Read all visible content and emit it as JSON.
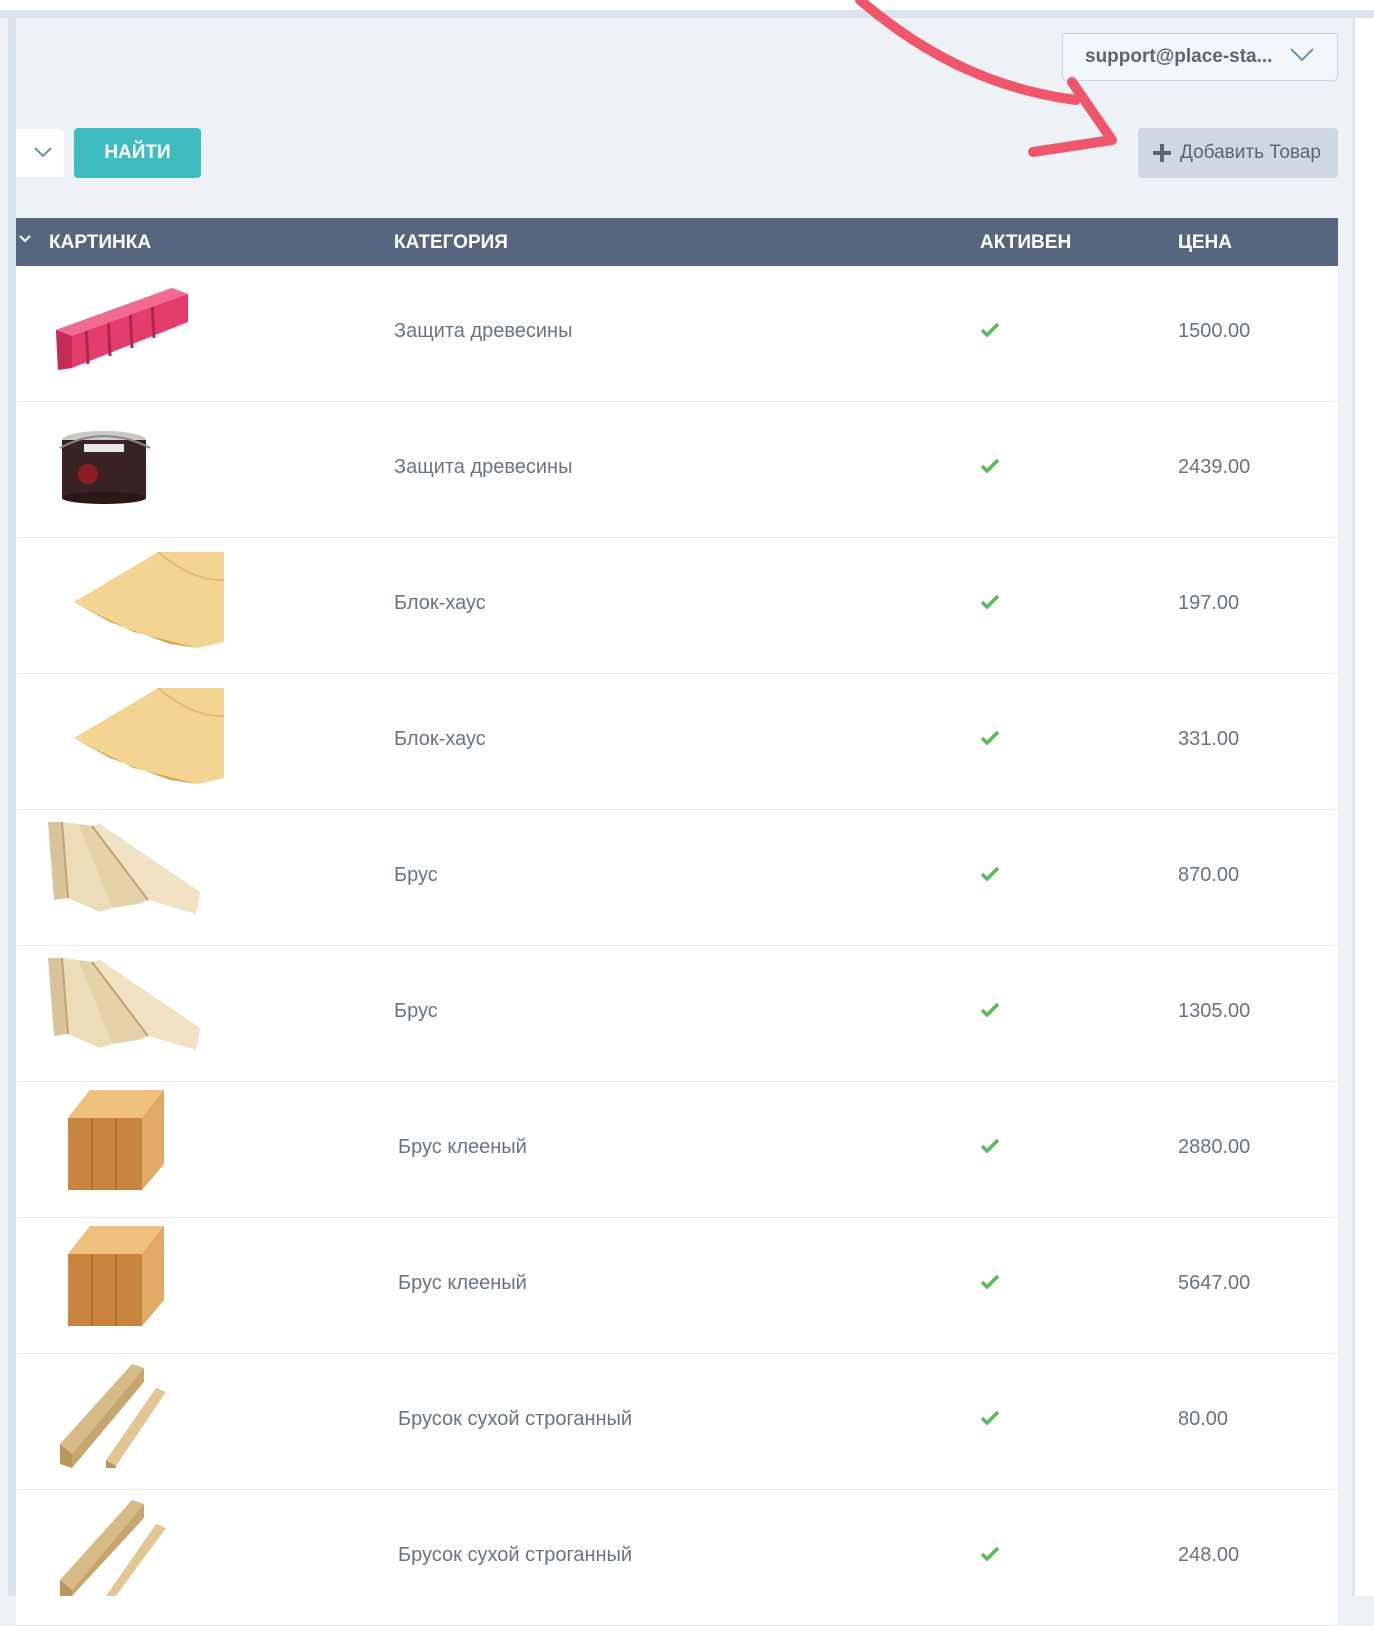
{
  "header": {
    "user_email": "support@place-sta...",
    "find_label": "НАЙТИ",
    "add_label": "Добавить Товар"
  },
  "table": {
    "columns": [
      "КАРТИНКА",
      "КАТЕГОРИЯ",
      "АКТИВЕН",
      "ЦЕНА"
    ],
    "rows": [
      {
        "image": "pink-boards-image",
        "category": "Защита древесины",
        "active": true,
        "price": "1500.00"
      },
      {
        "image": "paint-can-image",
        "category": "Защита древесины",
        "active": true,
        "price": "2439.00"
      },
      {
        "image": "block-house-image",
        "category": "Блок-хаус",
        "active": true,
        "price": "197.00"
      },
      {
        "image": "block-house-image",
        "category": "Блок-хаус",
        "active": true,
        "price": "331.00"
      },
      {
        "image": "beams-image",
        "category": "Брус",
        "active": true,
        "price": "870.00"
      },
      {
        "image": "beams-image",
        "category": "Брус",
        "active": true,
        "price": "1305.00"
      },
      {
        "image": "glued-beam-image",
        "category": "Брус клееный",
        "active": true,
        "price": "2880.00"
      },
      {
        "image": "glued-beam-image",
        "category": "Брус клееный",
        "active": true,
        "price": "5647.00"
      },
      {
        "image": "dry-bars-image",
        "category": "Брусок сухой строганный",
        "active": true,
        "price": "80.00"
      },
      {
        "image": "dry-bars-image",
        "category": "Брусок сухой строганный",
        "active": true,
        "price": "248.00"
      }
    ]
  },
  "colors": {
    "find_button": "#3fbcbf",
    "table_header": "#57657e",
    "check": "#5cb85c",
    "annotation_arrow": "#f0566a"
  }
}
